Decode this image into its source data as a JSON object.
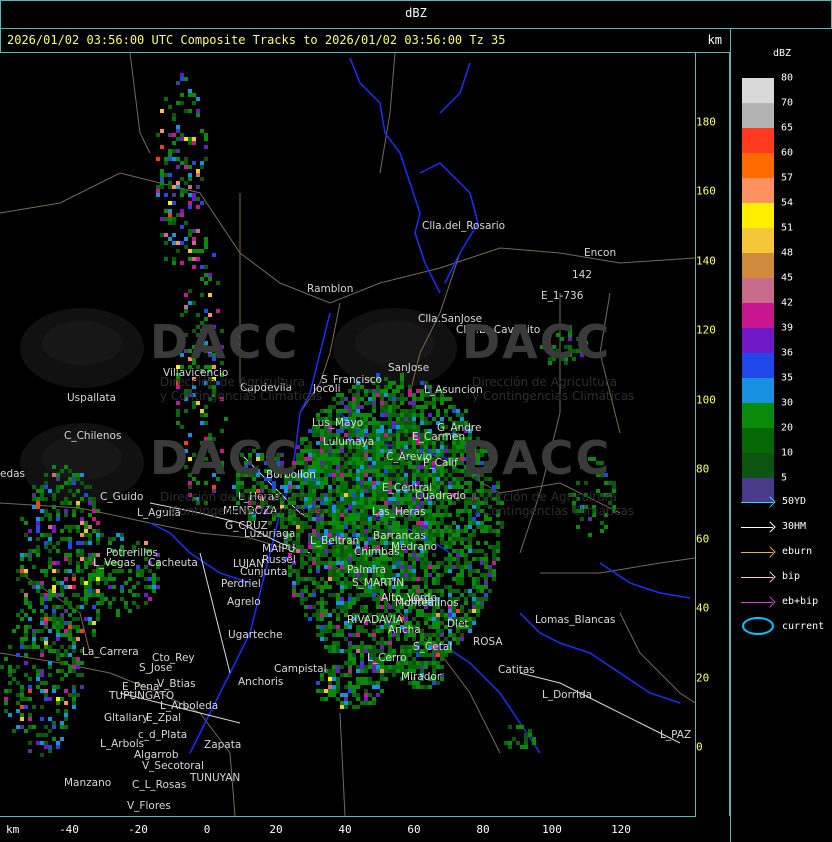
{
  "topbar": {
    "title": "dBZ"
  },
  "header": {
    "title": "2026/01/02 03:56:00 UTC Composite Tracks to 2026/01/02 03:56:00 Tz 35",
    "unit": "km"
  },
  "x_axis": {
    "unit": "km",
    "ticks": [
      "-40",
      "-20",
      "0",
      "20",
      "40",
      "60",
      "80",
      "100",
      "120"
    ]
  },
  "y_axis": {
    "ticks": [
      "180",
      "160",
      "140",
      "120",
      "100",
      "80",
      "60",
      "40",
      "20",
      "0"
    ]
  },
  "legend": {
    "unit": "dBZ",
    "scale": [
      {
        "value": "80",
        "color": "#d9d9d9"
      },
      {
        "value": "70",
        "color": "#b3b3b3"
      },
      {
        "value": "65",
        "color": "#ff3b1f"
      },
      {
        "value": "60",
        "color": "#ff6a00"
      },
      {
        "value": "57",
        "color": "#ff9060"
      },
      {
        "value": "54",
        "color": "#ffee00"
      },
      {
        "value": "51",
        "color": "#f5c53a"
      },
      {
        "value": "48",
        "color": "#d08a3c"
      },
      {
        "value": "45",
        "color": "#c86a8a"
      },
      {
        "value": "42",
        "color": "#c81690"
      },
      {
        "value": "39",
        "color": "#7018c8"
      },
      {
        "value": "36",
        "color": "#2048e8"
      },
      {
        "value": "35",
        "color": "#1890e0"
      },
      {
        "value": "30",
        "color": "#0a8a0a"
      },
      {
        "value": "20",
        "color": "#056805"
      },
      {
        "value": "10",
        "color": "#0c5510"
      },
      {
        "value": "5",
        "color": "#4a3a8c"
      }
    ],
    "tracks": [
      {
        "label": "50YD",
        "color": "#40d0e0"
      },
      {
        "label": "30HM",
        "color": "#ffffff"
      },
      {
        "label": "eburn",
        "color": "#e8b050"
      },
      {
        "label": "bip",
        "color": "#ffc8c8"
      },
      {
        "label": "eb+bip",
        "color": "#d040d0"
      }
    ],
    "current_label": "current"
  },
  "map": {
    "watermark": {
      "text": "DACC",
      "sub1": "Dirección de Agricultura",
      "sub2": "y Contingencias Climáticas"
    },
    "places": [
      "Clla.del_Rosario",
      "Encon",
      "142",
      "E_1-736",
      "Ramblon",
      "Clla.SanJose",
      "Clla.El_Cavadito",
      "Villavicencio",
      "Uspallata",
      "Capdevila",
      "S_Francisco",
      "SanJose",
      "L_Asuncion",
      "Lus_Mayo",
      "Jocoli",
      "C_Chilenos",
      "G_Andre",
      "E_Carmen",
      "Lulumaya",
      "C_Arevio",
      "P_Calif",
      "Borbollon",
      "C_Guido",
      "E_Central",
      "Cuadrado",
      "L_Heras",
      "MENDOZA",
      "L_Aguila",
      "Las_Heras",
      "G_CRUZ",
      "Luzuriaga",
      "L_Beltran",
      "Barrancas",
      "MAIPU",
      "Potrerillos",
      "Russel",
      "L_Vegas",
      "Cacheuta",
      "LUJAN",
      "Cunjunta",
      "Perdriel",
      "Agrelo",
      "Ugarteche",
      "S_MARTIN",
      "Palmira",
      "Medrano",
      "Junin",
      "RIVADAVIA",
      "La_Carrera",
      "Cto_Rey",
      "S_Jose",
      "E_Pena",
      "TUPUNGATO",
      "V_Btias",
      "Anchoris",
      "L_Arboleda",
      "Gltallary",
      "E_Zpal",
      "c_d_Plata",
      "L_Arbols",
      "Zapata",
      "Algarrob",
      "V_Secotoral",
      "TUNUYAN",
      "Manzano",
      "C_L_Rosas",
      "V_Flores",
      "Lomas_Blancas",
      "Catitas",
      "L_Dorrida",
      "L_PAZ",
      "Mirador",
      "L_Cerro",
      "Dlet",
      "ROSA",
      "Campistal",
      "Alto_Verde",
      "Chimbas",
      "edas",
      "Montealinos",
      "S_Cetal",
      "Ancha"
    ]
  }
}
